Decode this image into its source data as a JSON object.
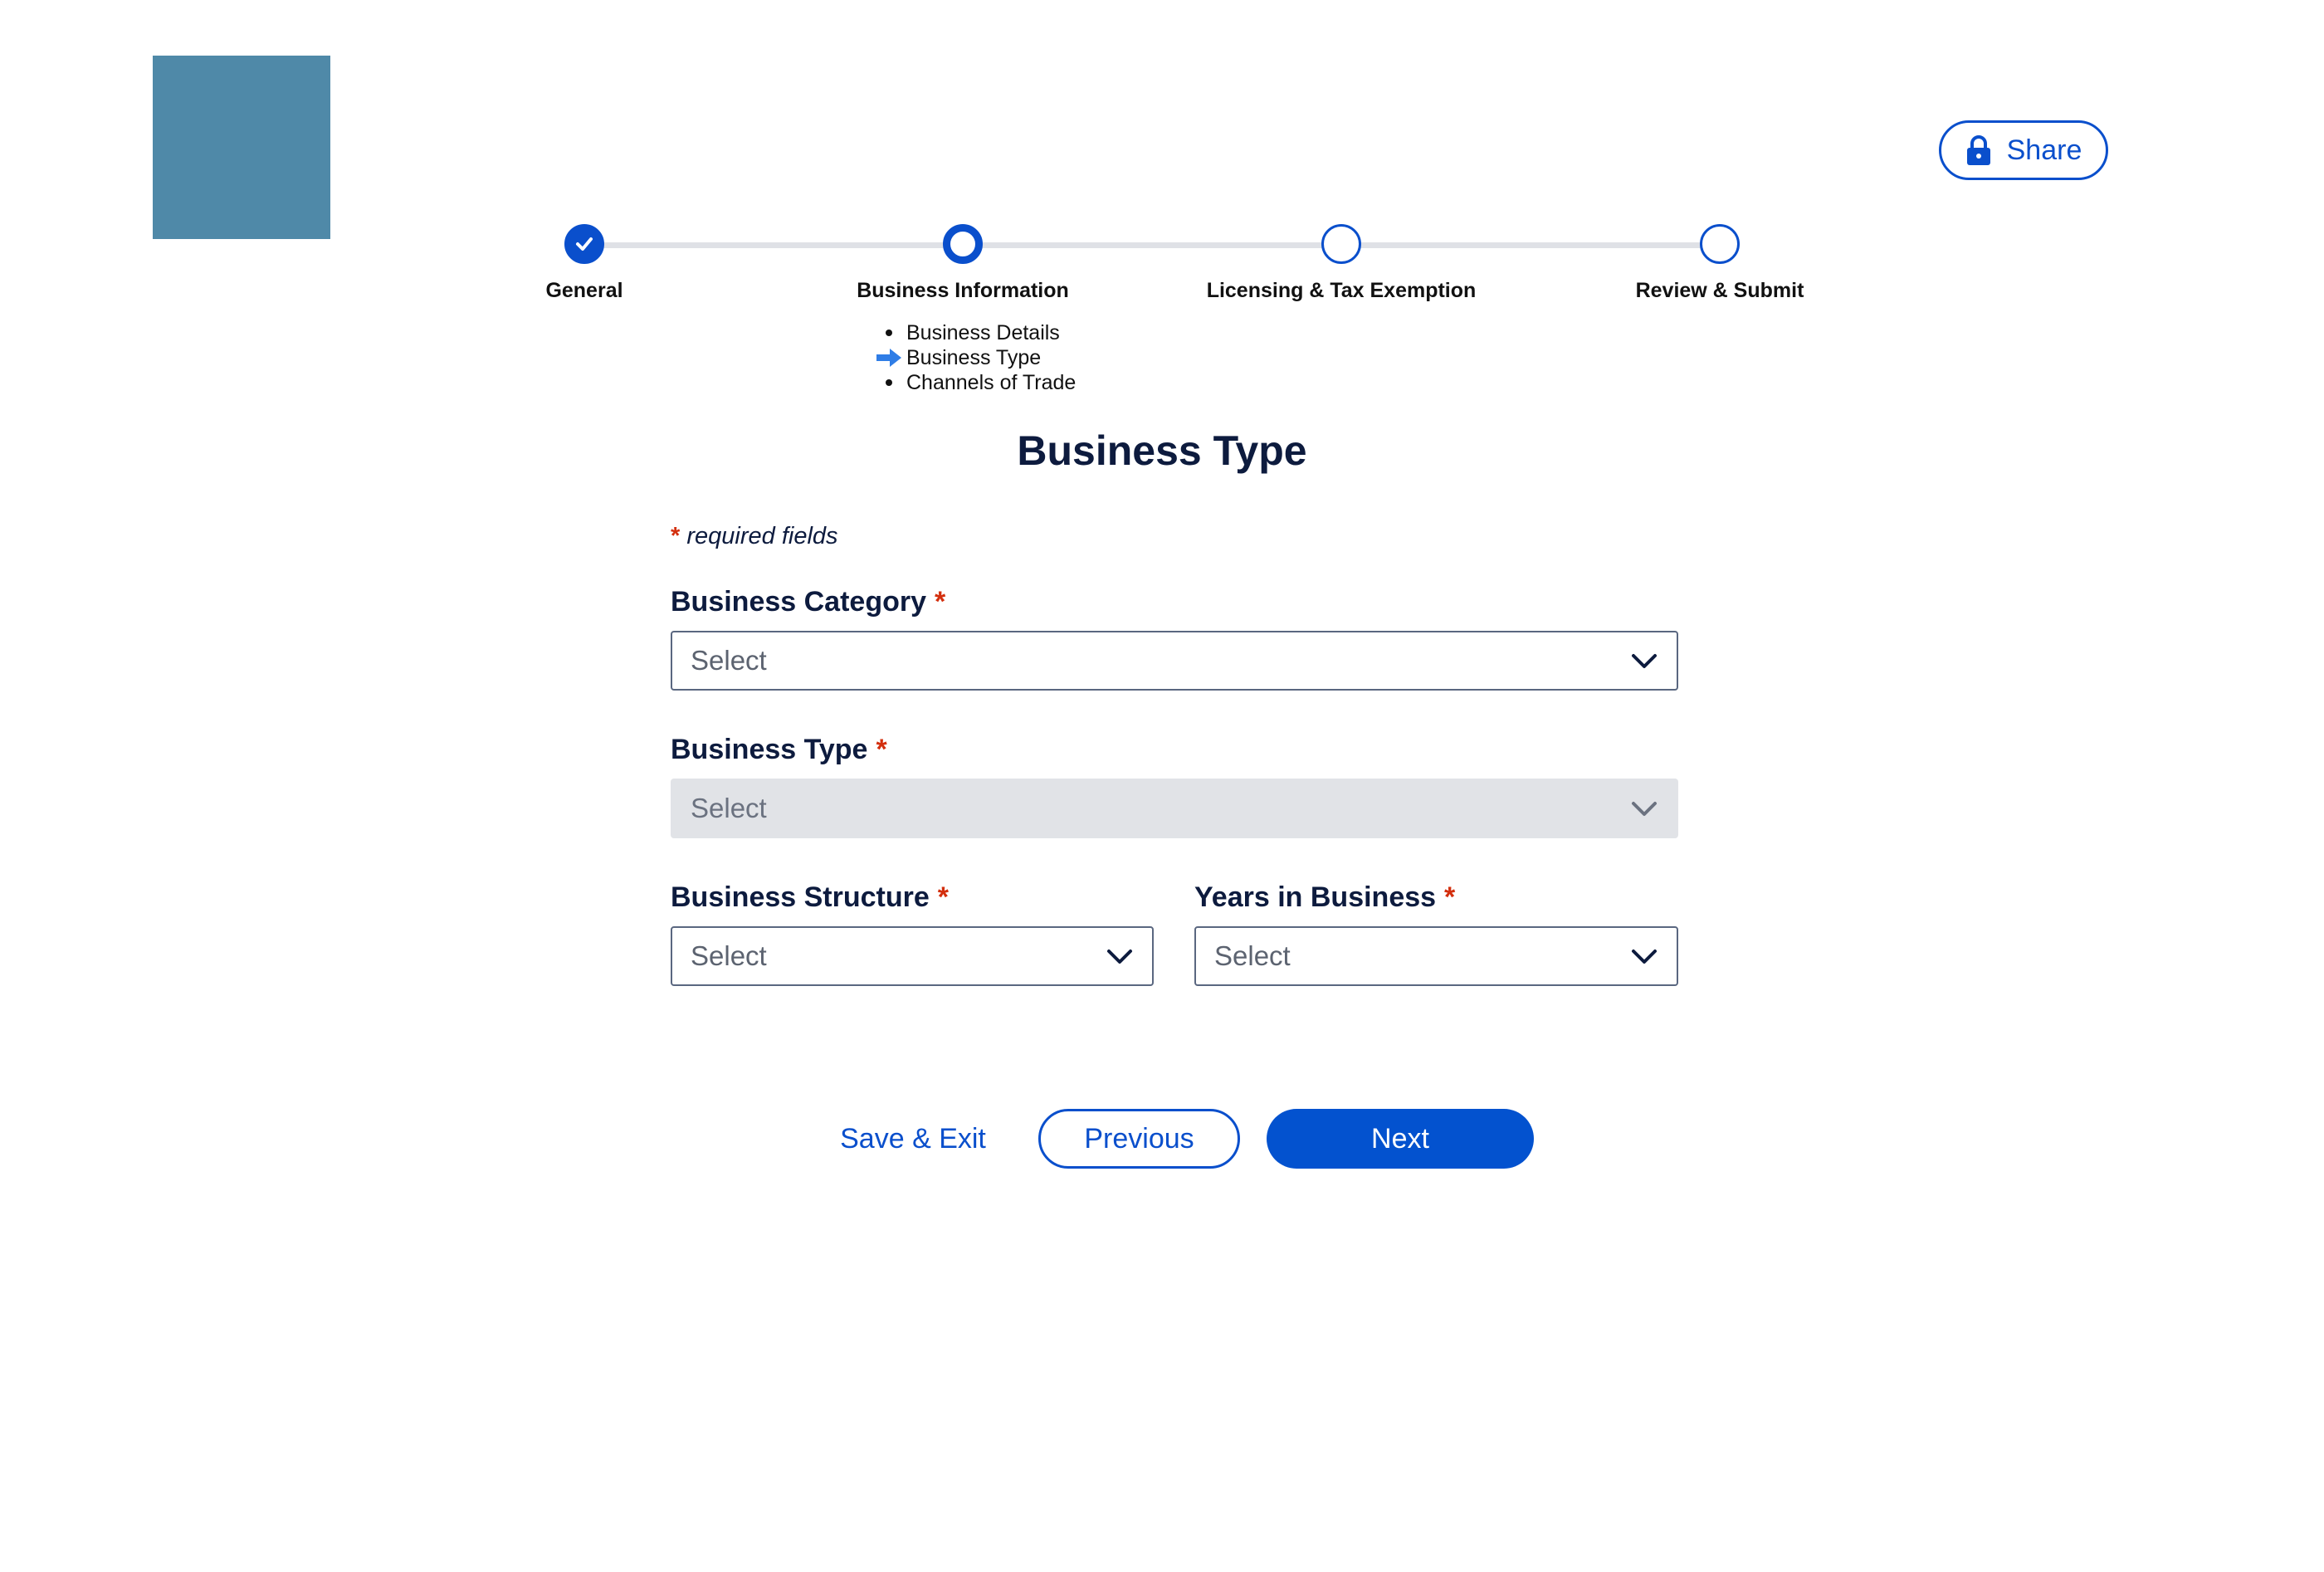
{
  "header": {
    "share_label": "Share",
    "share_icon": "lock-icon"
  },
  "stepper": {
    "steps": [
      {
        "label": "General",
        "status": "complete"
      },
      {
        "label": "Business Information",
        "status": "current"
      },
      {
        "label": "Licensing & Tax Exemption",
        "status": "upcoming"
      },
      {
        "label": "Review & Submit",
        "status": "upcoming"
      }
    ],
    "substeps": [
      {
        "label": "Business Details",
        "current": false
      },
      {
        "label": "Business Type",
        "current": true
      },
      {
        "label": "Channels of Trade",
        "current": false
      }
    ]
  },
  "main": {
    "title": "Business Type",
    "required_note": "required fields",
    "required_marker": "*"
  },
  "form": {
    "business_category": {
      "label": "Business Category",
      "value": "Select",
      "disabled": false
    },
    "business_type": {
      "label": "Business Type",
      "value": "Select",
      "disabled": true
    },
    "business_structure": {
      "label": "Business Structure",
      "value": "Select",
      "disabled": false
    },
    "years_in_business": {
      "label": "Years in Business",
      "value": "Select",
      "disabled": false
    }
  },
  "actions": {
    "save_exit": "Save & Exit",
    "previous": "Previous",
    "next": "Next"
  },
  "colors": {
    "primary": "#0a4fcc",
    "required": "#d32f0e",
    "text_dark": "#0d1b3e",
    "logo": "#4f89a8",
    "disabled_bg": "#e1e3e7"
  }
}
